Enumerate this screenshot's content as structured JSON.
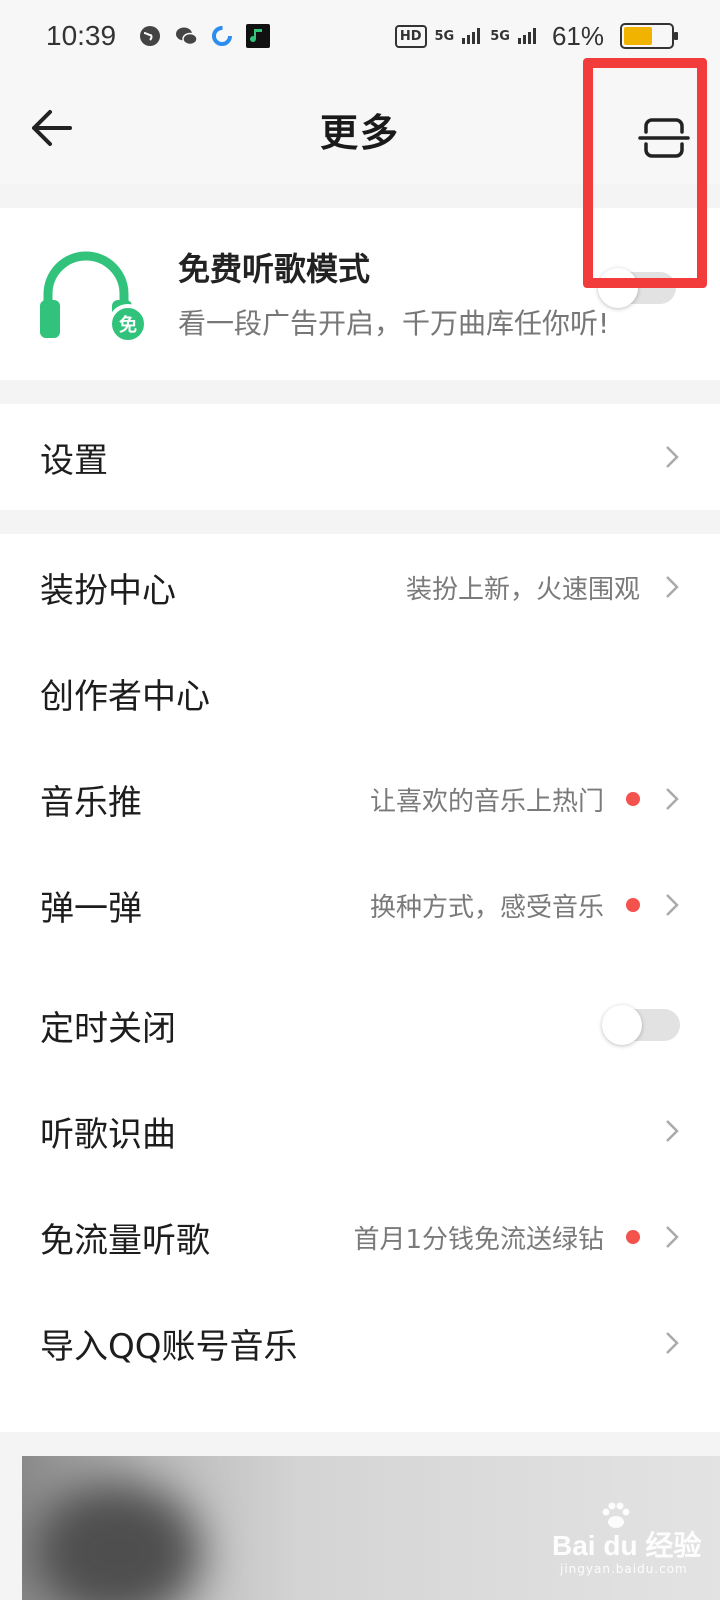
{
  "status_bar": {
    "time": "10:39",
    "network_labels": [
      "HD",
      "5G",
      "5G"
    ],
    "battery_text": "61%",
    "battery_level": 0.61
  },
  "header": {
    "title": "更多",
    "back_icon": "back-arrow-icon",
    "scan_icon": "scan-icon"
  },
  "free_mode": {
    "title": "免费听歌模式",
    "subtitle": "看一段广告开启，千万曲库任你听!",
    "badge": "免",
    "enabled": false
  },
  "settings": {
    "label": "设置"
  },
  "group2": [
    {
      "label": "装扮中心",
      "desc": "装扮上新，火速围观",
      "dot": false,
      "chevron": true
    },
    {
      "label": "创作者中心",
      "desc": "",
      "dot": false,
      "chevron": false
    },
    {
      "label": "音乐推",
      "desc": "让喜欢的音乐上热门",
      "dot": true,
      "chevron": true
    },
    {
      "label": "弹一弹",
      "desc": "换种方式，感受音乐",
      "dot": true,
      "chevron": true
    }
  ],
  "group3": [
    {
      "label": "定时关闭",
      "toggle": true,
      "enabled": false
    },
    {
      "label": "听歌识曲",
      "desc": "",
      "chevron": true
    },
    {
      "label": "免流量听歌",
      "desc": "首月1分钱免流送绿钻",
      "dot": true,
      "chevron": true
    },
    {
      "label": "导入QQ账号音乐",
      "desc": "",
      "chevron": true
    }
  ],
  "watermark": {
    "main": "Bai du 经验",
    "sub": "jingyan.baidu.com"
  },
  "colors": {
    "accent_green": "#31c27c",
    "highlight_red": "#f23b3b",
    "dot_red": "#f4524d"
  }
}
